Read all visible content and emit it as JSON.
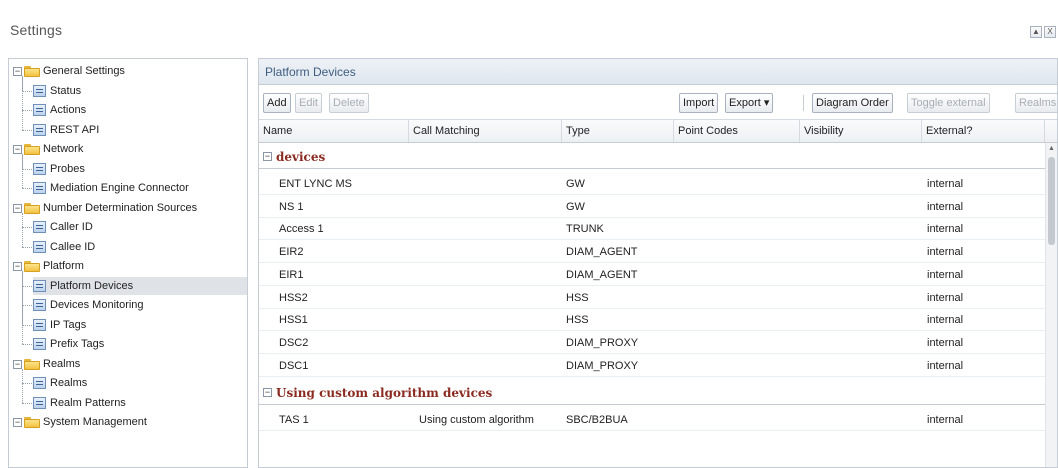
{
  "window": {
    "title": "Settings",
    "buttons": {
      "minimize": "▲",
      "close": "X"
    }
  },
  "tree": {
    "items": [
      {
        "label": "General Settings",
        "type": "folder"
      },
      {
        "label": "Status",
        "type": "leaf"
      },
      {
        "label": "Actions",
        "type": "leaf"
      },
      {
        "label": "REST API",
        "type": "leaf"
      },
      {
        "label": "Network",
        "type": "folder"
      },
      {
        "label": "Probes",
        "type": "leaf"
      },
      {
        "label": "Mediation Engine Connector",
        "type": "leaf"
      },
      {
        "label": "Number Determination Sources",
        "type": "folder"
      },
      {
        "label": "Caller ID",
        "type": "leaf"
      },
      {
        "label": "Callee ID",
        "type": "leaf"
      },
      {
        "label": "Platform",
        "type": "folder"
      },
      {
        "label": "Platform Devices",
        "type": "leaf",
        "selected": true
      },
      {
        "label": "Devices Monitoring",
        "type": "leaf"
      },
      {
        "label": "IP Tags",
        "type": "leaf"
      },
      {
        "label": "Prefix Tags",
        "type": "leaf"
      },
      {
        "label": "Realms",
        "type": "folder"
      },
      {
        "label": "Realms",
        "type": "leaf"
      },
      {
        "label": "Realm Patterns",
        "type": "leaf"
      },
      {
        "label": "System Management",
        "type": "folder"
      }
    ]
  },
  "panel": {
    "title": "Platform Devices",
    "toolbar": {
      "add": "Add",
      "edit": "Edit",
      "delete": "Delete",
      "import": "Import",
      "export": "Export ▾",
      "diagram_order": "Diagram Order",
      "toggle_external": "Toggle external",
      "realms": "Realms"
    },
    "columns": [
      "Name",
      "Call Matching",
      "Type",
      "Point Codes",
      "Visibility",
      "External?"
    ],
    "groups": [
      {
        "label": "devices",
        "rows": [
          {
            "name": "ENT LYNC MS",
            "call_matching": "",
            "type": "GW",
            "point_codes": "",
            "visibility": "",
            "external": "internal"
          },
          {
            "name": "NS 1",
            "call_matching": "",
            "type": "GW",
            "point_codes": "",
            "visibility": "",
            "external": "internal"
          },
          {
            "name": "Access 1",
            "call_matching": "",
            "type": "TRUNK",
            "point_codes": "",
            "visibility": "",
            "external": "internal"
          },
          {
            "name": "EIR2",
            "call_matching": "",
            "type": "DIAM_AGENT",
            "point_codes": "",
            "visibility": "",
            "external": "internal"
          },
          {
            "name": "EIR1",
            "call_matching": "",
            "type": "DIAM_AGENT",
            "point_codes": "",
            "visibility": "",
            "external": "internal"
          },
          {
            "name": "HSS2",
            "call_matching": "",
            "type": "HSS",
            "point_codes": "",
            "visibility": "",
            "external": "internal"
          },
          {
            "name": "HSS1",
            "call_matching": "",
            "type": "HSS",
            "point_codes": "",
            "visibility": "",
            "external": "internal"
          },
          {
            "name": "DSC2",
            "call_matching": "",
            "type": "DIAM_PROXY",
            "point_codes": "",
            "visibility": "",
            "external": "internal"
          },
          {
            "name": "DSC1",
            "call_matching": "",
            "type": "DIAM_PROXY",
            "point_codes": "",
            "visibility": "",
            "external": "internal"
          }
        ]
      },
      {
        "label": "Using custom algorithm devices",
        "rows": [
          {
            "name": "TAS 1",
            "call_matching": "Using custom algorithm",
            "type": "SBC/B2BUA",
            "point_codes": "",
            "visibility": "",
            "external": "internal"
          }
        ]
      }
    ]
  }
}
